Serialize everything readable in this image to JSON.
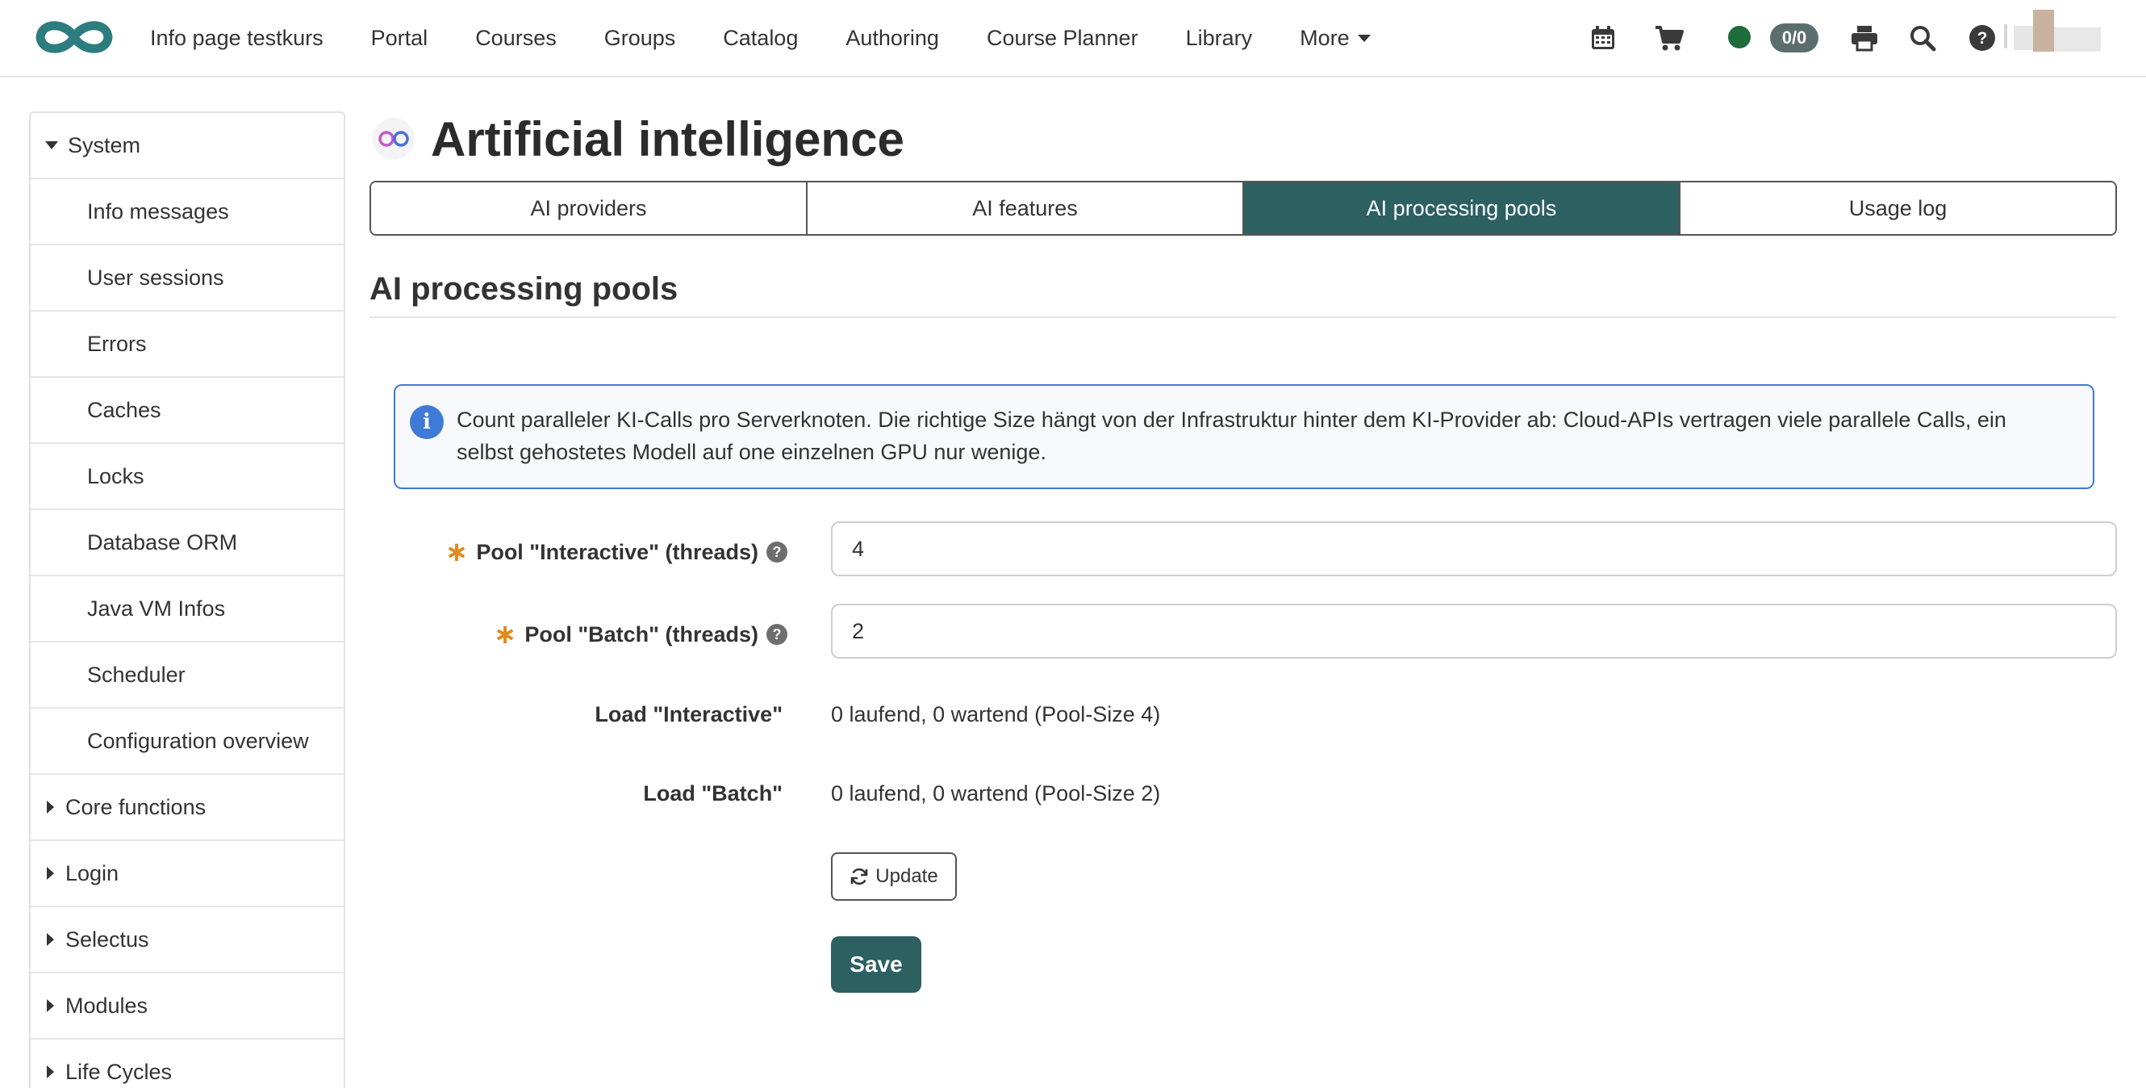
{
  "nav": {
    "items": [
      "Info page testkurs",
      "Portal",
      "Courses",
      "Groups",
      "Catalog",
      "Authoring",
      "Course Planner",
      "Library",
      "More"
    ],
    "count_badge": "0/0",
    "status_color": "#1e6b3c",
    "icons": [
      "logo-infinity-icon",
      "calendar-icon",
      "cart-icon",
      "printer-icon",
      "search-icon",
      "help-icon"
    ]
  },
  "sidebar": {
    "expanded": "System",
    "sub_items": [
      "Info messages",
      "User sessions",
      "Errors",
      "Caches",
      "Locks",
      "Database ORM",
      "Java VM Infos",
      "Scheduler",
      "Configuration overview"
    ],
    "collapsed": [
      "Core functions",
      "Login",
      "Selectus",
      "Modules",
      "Life Cycles"
    ]
  },
  "page": {
    "title": "Artificial intelligence",
    "tabs": [
      "AI providers",
      "AI features",
      "AI processing pools",
      "Usage log"
    ],
    "active_tab": "AI processing pools",
    "section_title": "AI processing pools"
  },
  "info": {
    "text": "Count paralleler KI-Calls pro Serverknoten. Die richtige Size hängt von der Infrastruktur hinter dem KI-Provider ab: Cloud-APIs vertragen viele parallele Calls, ein selbst gehostetes Modell auf one einzelnen GPU nur wenige."
  },
  "form": {
    "pool_interactive_label": "Pool \"Interactive\" (threads)",
    "pool_interactive_value": "4",
    "pool_batch_label": "Pool \"Batch\" (threads)",
    "pool_batch_value": "2",
    "load_interactive_label": "Load \"Interactive\"",
    "load_interactive_value": "0 laufend, 0 wartend (Pool-Size 4)",
    "load_batch_label": "Load \"Batch\"",
    "load_batch_value": "0 laufend, 0 wartend (Pool-Size 2)",
    "required_mark": "∗",
    "help_mark": "?",
    "update_label": "Update",
    "save_label": "Save"
  },
  "colors": {
    "brand": "#2d6061",
    "info_border": "#3f7ad6",
    "required": "#e08a1e"
  }
}
